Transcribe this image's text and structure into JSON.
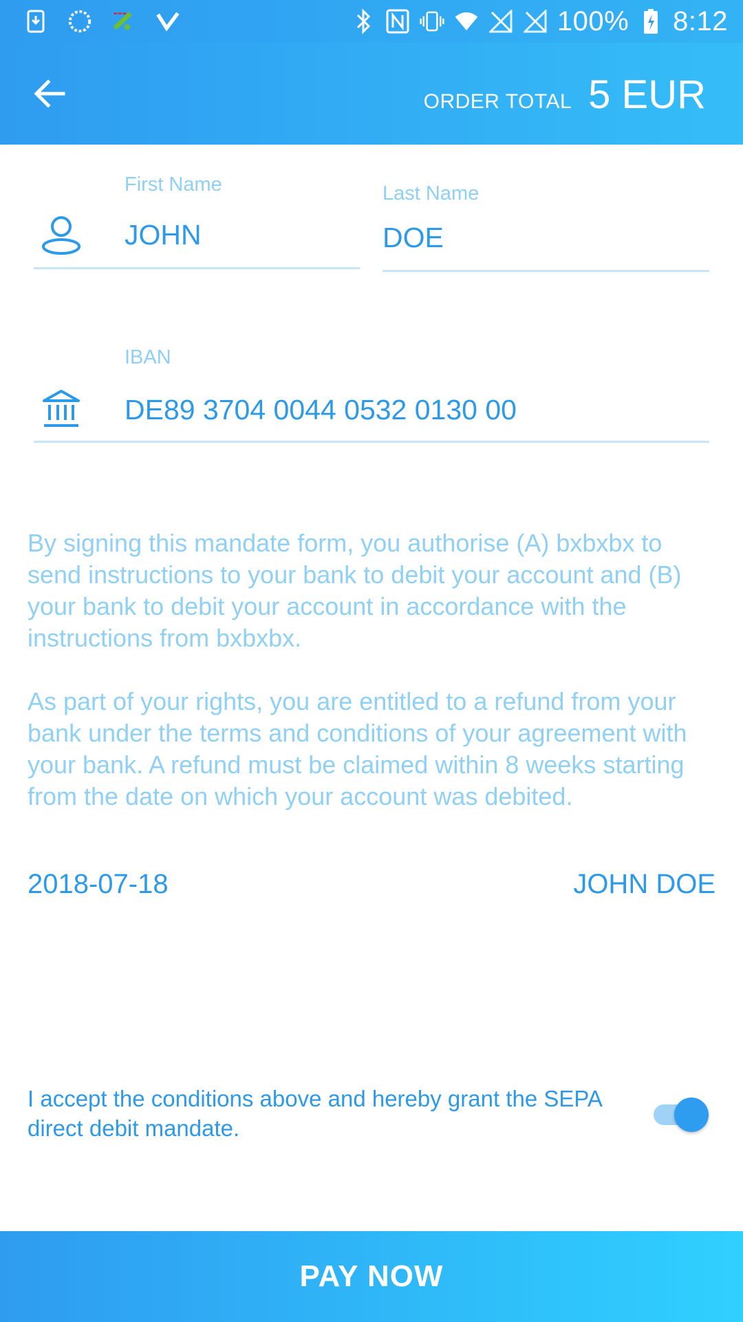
{
  "status_bar": {
    "battery": "100%",
    "time": "8:12",
    "icons_left": [
      "download-icon",
      "loading-icon",
      "fake-gps-icon",
      "check-icon"
    ],
    "icons_right": [
      "bluetooth-icon",
      "nfc-icon",
      "vibrate-icon",
      "wifi-icon",
      "no-sim-icon",
      "no-sim-2-icon",
      "battery-icon"
    ]
  },
  "app_bar": {
    "order_total_label": "ORDER TOTAL",
    "order_total_value": "5 EUR"
  },
  "form": {
    "first_name": {
      "label": "First Name",
      "value": "JOHN"
    },
    "last_name": {
      "label": "Last Name",
      "value": "DOE"
    },
    "iban": {
      "label": "IBAN",
      "value": "DE89 3704 0044 0532 0130 00"
    }
  },
  "mandate": {
    "paragraph_1": "By signing this mandate form, you authorise (A) bxbxbx to send instructions to your bank to debit your account and (B) your bank to debit your account in accordance with the instructions from bxbxbx.",
    "paragraph_2": "As part of your rights, you are entitled to a refund from your bank under the terms and conditions of your agreement with your bank. A refund must be claimed within 8 weeks starting from the date on which your account was debited.",
    "date": "2018-07-18",
    "signer": "JOHN DOE"
  },
  "accept": {
    "text": "I accept the conditions above and hereby grant the SEPA direct debit mandate.",
    "toggle_on": true
  },
  "pay_button": {
    "label": "PAY NOW"
  },
  "colors": {
    "primary": "#2c9ae8",
    "label": "#8fd0f4",
    "header_start": "#2f9cf0",
    "header_end": "#35bdf8"
  }
}
